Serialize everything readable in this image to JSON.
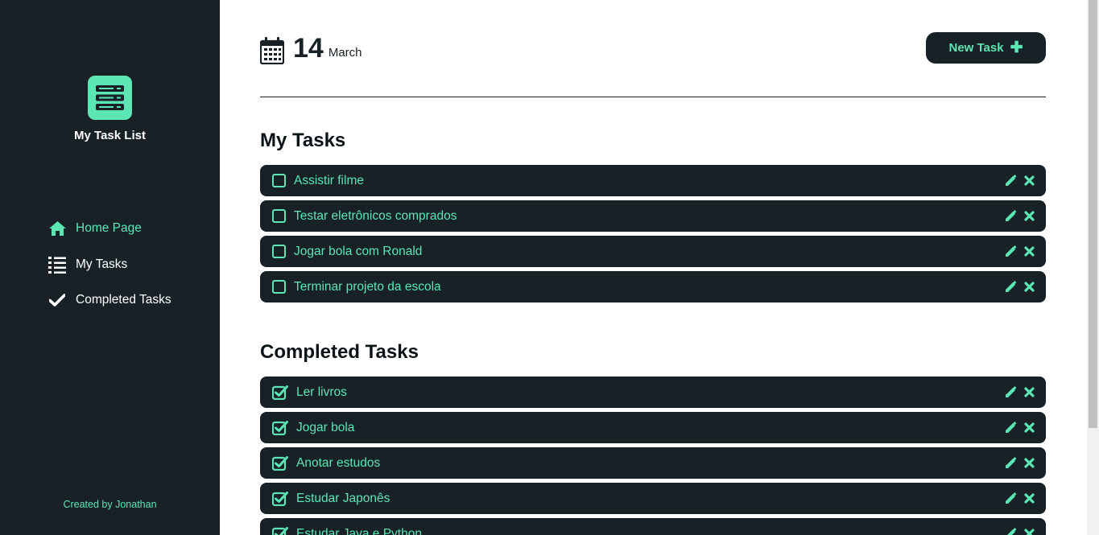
{
  "sidebar": {
    "app_title": "My Task List",
    "logo_icon": "server-stack-icon",
    "nav": [
      {
        "label": "Home Page",
        "icon": "home-icon",
        "active": true
      },
      {
        "label": "My Tasks",
        "icon": "list-icon",
        "active": false
      },
      {
        "label": "Completed Tasks",
        "icon": "check-icon",
        "active": false
      }
    ],
    "credit": "Created by Jonathan"
  },
  "header": {
    "date_day": "14",
    "date_month": "March",
    "calendar_icon": "calendar-icon",
    "new_task_label": "New Task",
    "new_task_icon": "plus-icon"
  },
  "my_tasks": {
    "title": "My Tasks",
    "items": [
      {
        "label": "Assistir filme",
        "done": false
      },
      {
        "label": "Testar eletrônicos comprados",
        "done": false
      },
      {
        "label": "Jogar bola com Ronald",
        "done": false
      },
      {
        "label": "Terminar projeto da escola",
        "done": false
      }
    ]
  },
  "completed_tasks": {
    "title": "Completed Tasks",
    "items": [
      {
        "label": "Ler livros",
        "done": true
      },
      {
        "label": "Jogar bola",
        "done": true
      },
      {
        "label": "Anotar estudos",
        "done": true
      },
      {
        "label": "Estudar Japonês",
        "done": true
      },
      {
        "label": "Estudar Java e Python",
        "done": true
      }
    ]
  },
  "colors": {
    "sidebar_bg": "#172126",
    "accent": "#5ce6b4",
    "page_bg": "#ffffff"
  }
}
